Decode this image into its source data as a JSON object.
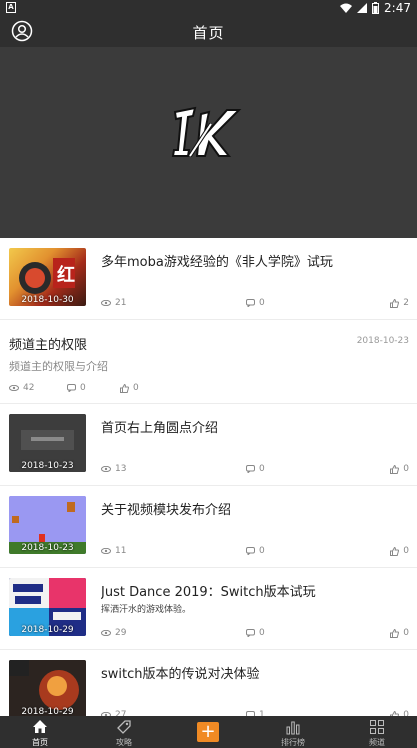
{
  "status_bar": {
    "left_icon": "A",
    "time": "2:47"
  },
  "header": {
    "title": "首页"
  },
  "banner": {
    "logo_text": "IK"
  },
  "feed": [
    {
      "kind": "media",
      "title": "多年moba游戏经验的《非人学院》试玩",
      "thumb_date": "2018-10-30",
      "views": "21",
      "comments": "0",
      "likes": "2"
    },
    {
      "kind": "text",
      "title": "频道主的权限",
      "date": "2018-10-23",
      "desc": "频道主的权限与介绍",
      "views": "42",
      "comments": "0",
      "likes": "0"
    },
    {
      "kind": "media",
      "title": "首页右上角圆点介绍",
      "thumb_date": "2018-10-23",
      "views": "13",
      "comments": "0",
      "likes": "0"
    },
    {
      "kind": "media",
      "title": "关于视频模块发布介绍",
      "thumb_date": "2018-10-23",
      "views": "11",
      "comments": "0",
      "likes": "0"
    },
    {
      "kind": "media",
      "title": "Just Dance 2019：Switch版本试玩",
      "desc": "挥洒汗水的游戏体验。",
      "thumb_date": "2018-10-29",
      "views": "29",
      "comments": "0",
      "likes": "0"
    },
    {
      "kind": "media",
      "title": "switch版本的传说对决体验",
      "thumb_date": "2018-10-29",
      "views": "27",
      "comments": "1",
      "likes": "0"
    }
  ],
  "bottom_nav": {
    "items": [
      {
        "label": "首页",
        "icon": "home-icon"
      },
      {
        "label": "攻略",
        "icon": "tag-icon"
      },
      {
        "label": "",
        "icon": "plus-icon"
      },
      {
        "label": "排行榜",
        "icon": "bar-chart-icon"
      },
      {
        "label": "频道",
        "icon": "grid-icon"
      }
    ]
  },
  "colors": {
    "bar_bg": "#2f2f2f",
    "banner_bg": "#3b3b3b",
    "accent": "#f08a24"
  }
}
